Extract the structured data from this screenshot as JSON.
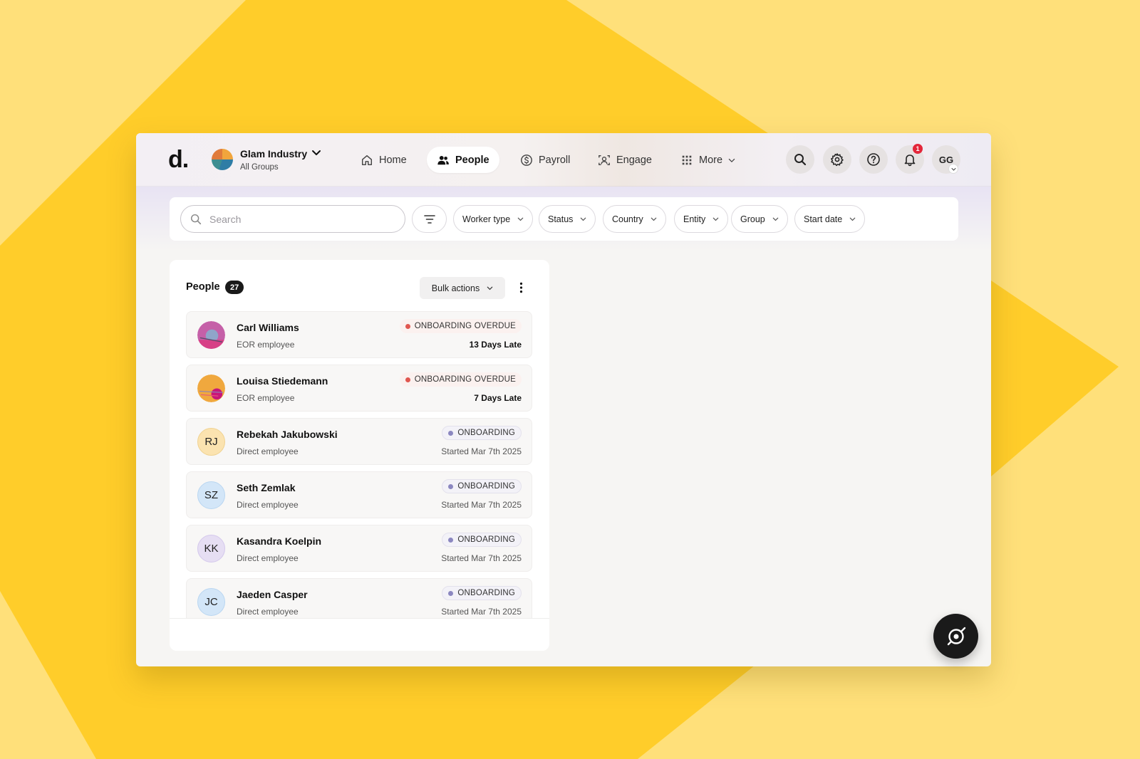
{
  "app": {
    "logo": "d.",
    "org_name": "Glam Industry",
    "org_sub": "All Groups"
  },
  "nav": {
    "items": [
      {
        "label": "Home",
        "icon": "home-icon"
      },
      {
        "label": "People",
        "icon": "people-icon",
        "active": true
      },
      {
        "label": "Payroll",
        "icon": "dollar-circle-icon"
      },
      {
        "label": "Engage",
        "icon": "engage-icon"
      },
      {
        "label": "More",
        "icon": "grid-icon"
      }
    ]
  },
  "header_actions": {
    "notification_count": "1",
    "user_initials": "GG"
  },
  "filters": {
    "search_placeholder": "Search",
    "chips": [
      "Worker type",
      "Status",
      "Country",
      "Entity",
      "Group",
      "Start date"
    ]
  },
  "people": {
    "title": "People",
    "count": "27",
    "bulk_actions_label": "Bulk actions",
    "rows": [
      {
        "name": "Carl Williams",
        "type": "EOR employee",
        "status": "ONBOARDING OVERDUE",
        "meta": "13 Days Late",
        "initials": "",
        "avatar_kind": "photo-pink"
      },
      {
        "name": "Louisa Stiedemann",
        "type": "EOR employee",
        "status": "ONBOARDING OVERDUE",
        "meta": "7 Days Late",
        "initials": "",
        "avatar_kind": "photo-orange"
      },
      {
        "name": "Rebekah Jakubowski",
        "type": "Direct employee",
        "status": "ONBOARDING",
        "meta": "Started Mar 7th 2025",
        "initials": "RJ",
        "avatar_kind": "initials"
      },
      {
        "name": "Seth Zemlak",
        "type": "Direct employee",
        "status": "ONBOARDING",
        "meta": "Started Mar 7th 2025",
        "initials": "SZ",
        "avatar_kind": "initials"
      },
      {
        "name": "Kasandra Koelpin",
        "type": "Direct employee",
        "status": "ONBOARDING",
        "meta": "Started Mar 7th 2025",
        "initials": "KK",
        "avatar_kind": "initials"
      },
      {
        "name": "Jaeden Casper",
        "type": "Direct employee",
        "status": "ONBOARDING",
        "meta": "Started Mar 7th 2025",
        "initials": "JC",
        "avatar_kind": "initials"
      }
    ]
  },
  "colors": {
    "background_light": "#FFE07A",
    "background_yellow": "#FFCD2A",
    "overdue_dot": "#E0564F",
    "onboarding_dot": "#8B87C0",
    "notification_badge": "#E3263A",
    "fab": "#1A1A1A"
  }
}
